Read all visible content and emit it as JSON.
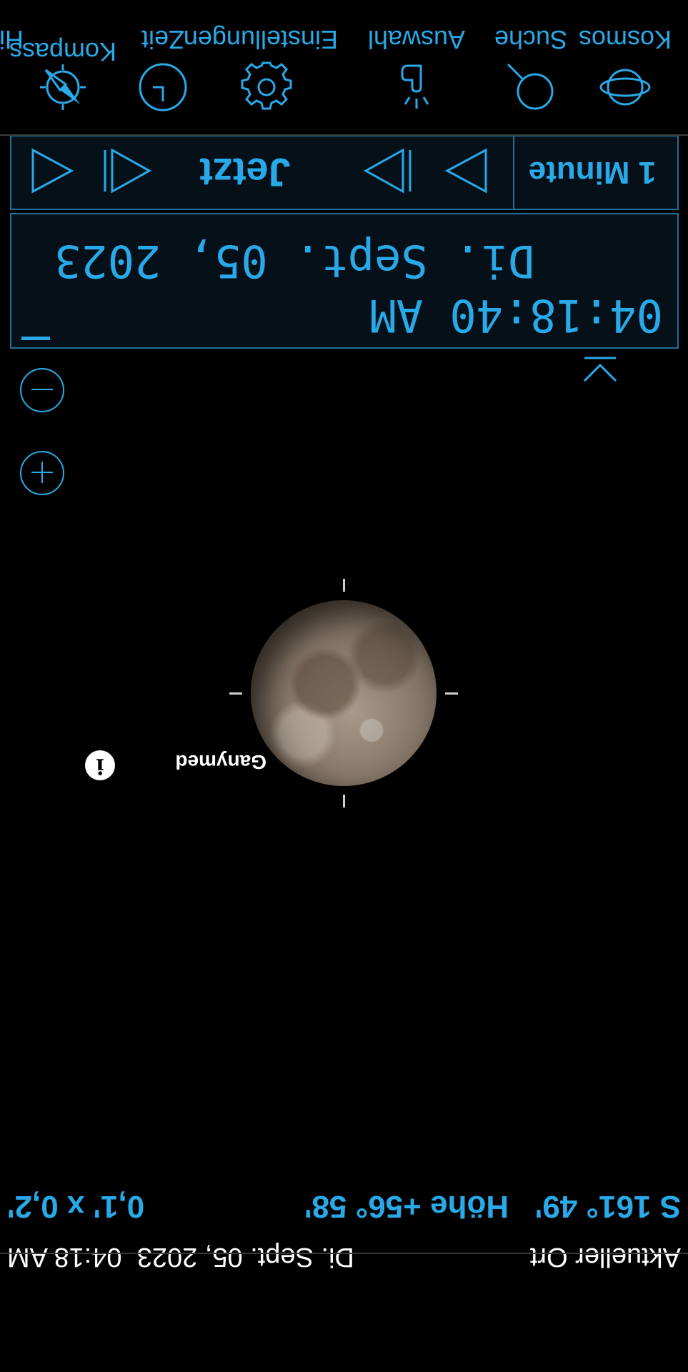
{
  "status_bar": {
    "location": "Aktueller Ort",
    "date": "Di. Sept. 05, 2023",
    "time": "04:18 AM"
  },
  "coordinates": {
    "azimuth": "S  161° 49'",
    "altitude": "Höhe +56° 58'",
    "field_of_view": "0,1' x 0,2'"
  },
  "object": {
    "name": "Ganymed"
  },
  "date_panel": {
    "date": "Di.  Sept.  05,  2023",
    "time": "04:18:40  AM"
  },
  "time_controls": {
    "step": "1 Minute",
    "now_label": "Jetzt"
  },
  "toolbar": {
    "items": [
      {
        "label": "Kosmos",
        "icon": "orbit-icon"
      },
      {
        "label": "Suche",
        "icon": "search-icon"
      },
      {
        "label": "Auswahl",
        "icon": "pointer-hand-icon"
      },
      {
        "label": "Einstellungen",
        "icon": "gear-icon"
      },
      {
        "label": "Zeit",
        "icon": "clock-icon"
      },
      {
        "label": "Kompass",
        "icon": "compass-icon"
      },
      {
        "label": "Hi",
        "icon": "help-icon"
      }
    ]
  },
  "colors": {
    "accent": "#29a9e8",
    "background": "#000000",
    "panel": "#051019",
    "panel_border": "#1f6f96"
  }
}
